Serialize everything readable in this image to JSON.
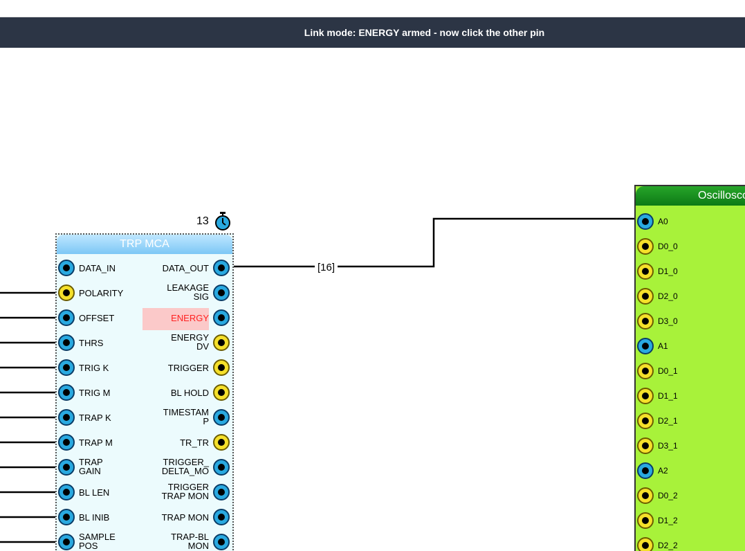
{
  "status_bar": {
    "message": "Link mode: ENERGY armed - now click the other pin"
  },
  "timer": {
    "value": "13"
  },
  "mca_block": {
    "title": "TRP MCA",
    "rows": [
      {
        "in": "DATA_IN",
        "in_color": "blue",
        "out": "DATA_OUT",
        "out_color": "blue"
      },
      {
        "in": "POLARITY",
        "in_color": "yellow",
        "out": "LEAKAGE\nSIG",
        "out_color": "blue"
      },
      {
        "in": "OFFSET",
        "in_color": "blue",
        "out": "ENERGY",
        "out_color": "blue",
        "highlight": true
      },
      {
        "in": "THRS",
        "in_color": "blue",
        "out": "ENERGY\nDV",
        "out_color": "yellow"
      },
      {
        "in": "TRIG K",
        "in_color": "blue",
        "out": "TRIGGER",
        "out_color": "yellow"
      },
      {
        "in": "TRIG M",
        "in_color": "blue",
        "out": "BL HOLD",
        "out_color": "yellow"
      },
      {
        "in": "TRAP K",
        "in_color": "blue",
        "out": "TIMESTAM\nP",
        "out_color": "blue"
      },
      {
        "in": "TRAP M",
        "in_color": "blue",
        "out": "TR_TR",
        "out_color": "yellow"
      },
      {
        "in": "TRAP\nGAIN",
        "in_color": "blue",
        "out": "TRIGGER_\nDELTA_MO",
        "out_color": "blue"
      },
      {
        "in": "BL LEN",
        "in_color": "blue",
        "out": "TRIGGER\nTRAP MON",
        "out_color": "blue"
      },
      {
        "in": "BL INIB",
        "in_color": "blue",
        "out": "TRAP MON",
        "out_color": "blue"
      },
      {
        "in": "SAMPLE\nPOS",
        "in_color": "blue",
        "out": "TRAP-BL\nMON",
        "out_color": "blue"
      }
    ]
  },
  "wire_label": "[16]",
  "osc_block": {
    "title": "Oscilloscope",
    "pins": [
      {
        "label": "A0",
        "color": "blue"
      },
      {
        "label": "D0_0",
        "color": "yellow"
      },
      {
        "label": "D1_0",
        "color": "yellow"
      },
      {
        "label": "D2_0",
        "color": "yellow"
      },
      {
        "label": "D3_0",
        "color": "yellow"
      },
      {
        "label": "A1",
        "color": "blue"
      },
      {
        "label": "D0_1",
        "color": "yellow"
      },
      {
        "label": "D1_1",
        "color": "yellow"
      },
      {
        "label": "D2_1",
        "color": "yellow"
      },
      {
        "label": "D3_1",
        "color": "yellow"
      },
      {
        "label": "A2",
        "color": "blue"
      },
      {
        "label": "D0_2",
        "color": "yellow"
      },
      {
        "label": "D1_2",
        "color": "yellow"
      },
      {
        "label": "D2_2",
        "color": "yellow"
      }
    ]
  },
  "colors": {
    "status_bg": "#2c3545",
    "pin_blue": "#29a9e0",
    "pin_yellow": "#f5e02a",
    "osc_bg": "#a8f23a",
    "mca_bg": "#ecfbfd",
    "highlight": "#fbc9c9"
  }
}
